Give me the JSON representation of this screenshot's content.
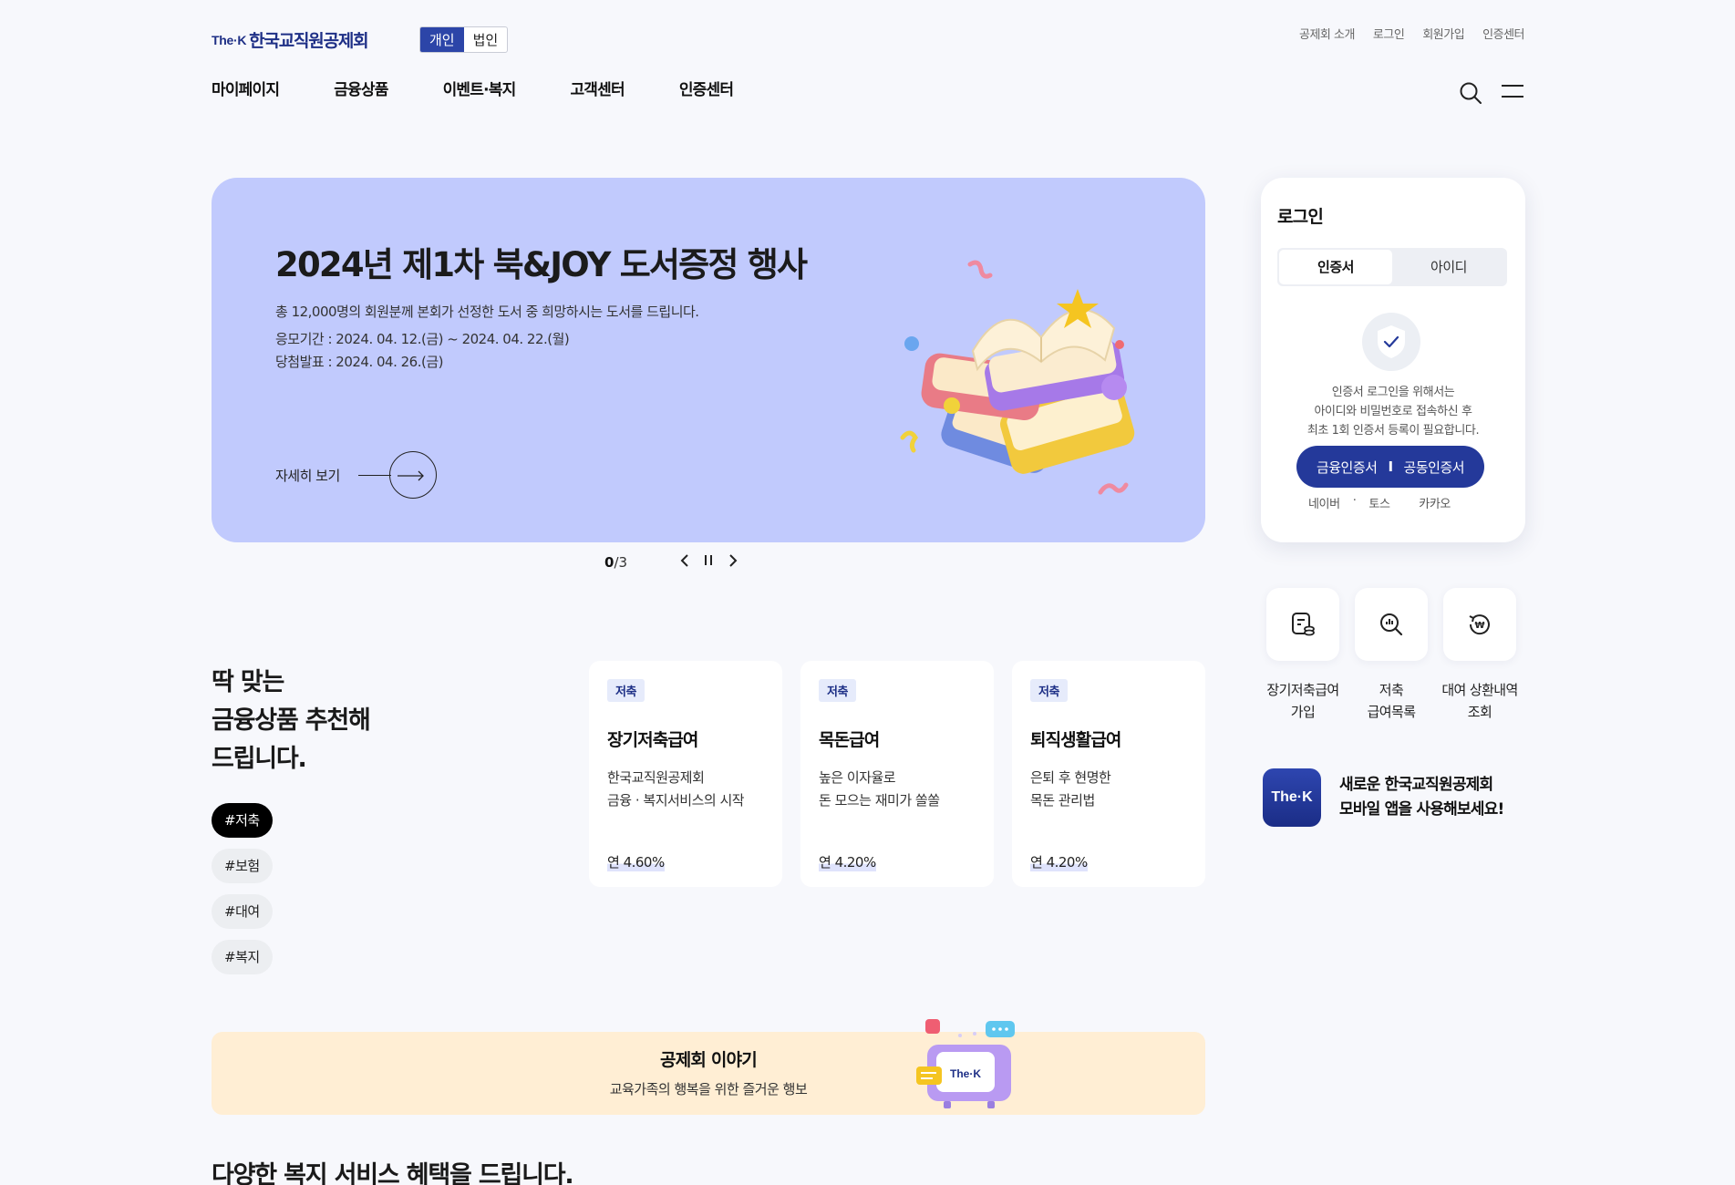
{
  "header": {
    "logo_mark": "The·K",
    "logo_name": "한국교직원공제회",
    "member_types": [
      "개인",
      "법인"
    ],
    "top_links": [
      "공제회 소개",
      "로그인",
      "회원가입",
      "인증센터"
    ],
    "gnb": [
      "마이페이지",
      "금융상품",
      "이벤트·복지",
      "고객센터",
      "인증센터"
    ],
    "icons": {
      "search": "search-icon",
      "menu": "hamburger-menu-icon"
    }
  },
  "hero": {
    "title": "2024년 제1차 북&JOY 도서증정 행사",
    "description": "총 12,000명의 회원분께 본회가 선정한 도서 중 희망하시는 도서를 드립니다.",
    "period": "응모기간 : 2024. 04. 12.(금) ~ 2024. 04. 22.(월)",
    "announcement": "당첨발표 : 2024. 04. 26.(금)",
    "more_label": "자세히 보기",
    "background_color": "#c1cafd"
  },
  "pager": {
    "current": "0",
    "total": "/3"
  },
  "login": {
    "title": "로그인",
    "tabs": [
      "인증서",
      "아이디"
    ],
    "guide": "인증서 로그인을 위해서는\n아이디와 비밀번호로 접속하신 후\n최초 1회 인증서 등록이 필요합니다.",
    "cert_buttons": [
      "금융인증서",
      "공동인증서"
    ],
    "cert_separator": "I",
    "social": [
      "네이버",
      "토스",
      "카카오"
    ],
    "social_separator": "·"
  },
  "quick_menu": [
    {
      "label": "장기저축급여\n가입",
      "icon": "savings-document-icon"
    },
    {
      "label": "저축\n급여목록",
      "icon": "search-chart-icon"
    },
    {
      "label": "대여 상환내역\n조회",
      "icon": "won-refresh-icon"
    }
  ],
  "app_promo": {
    "icon_text": "The·K",
    "text": "새로운 한국교직원공제회\n모바일 앱을 사용해보세요!"
  },
  "recommend": {
    "title": "딱 맞는\n금융상품 추천해\n드립니다.",
    "tags": [
      "#저축",
      "#보험",
      "#대여",
      "#복지"
    ],
    "products": [
      {
        "badge": "저축",
        "name": "장기저축급여",
        "desc": "한국교직원공제회\n금융 · 복지서비스의 시작",
        "rate": "연 4.60%"
      },
      {
        "badge": "저축",
        "name": "목돈급여",
        "desc": "높은 이자율로\n돈 모으는 재미가 쏠쏠",
        "rate": "연 4.20%"
      },
      {
        "badge": "저축",
        "name": "퇴직생활급여",
        "desc": "은퇴 후 현명한\n목돈 관리법",
        "rate": "연 4.20%"
      }
    ]
  },
  "story": {
    "title": "공제회 이야기",
    "description": "교육가족의 행복을 위한 즐거운 행보",
    "tv_text": "The·K"
  },
  "welfare": {
    "title": "다양한 복지 서비스 혜택을 드립니다."
  },
  "colors": {
    "brand": "#1e2f86",
    "accent": "#24399a",
    "story_bg": "#ffeed4"
  }
}
